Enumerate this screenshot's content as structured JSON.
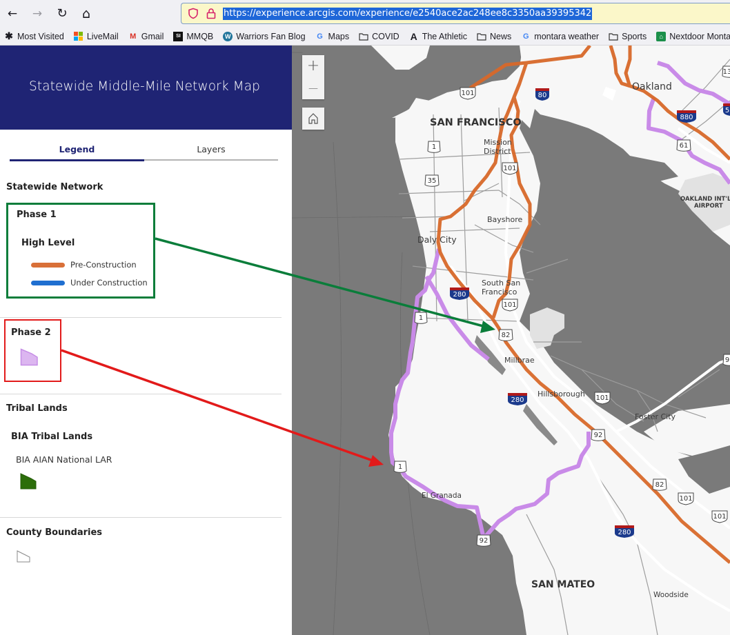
{
  "browser": {
    "back_label": "←",
    "forward_label": "→",
    "reload_label": "↻",
    "home_label": "⌂",
    "url": "https://experience.arcgis.com/experience/e2540ace2ac248ee8c3350aa39395342",
    "bookmarks": [
      {
        "label": "Most Visited",
        "icon": "gear-icon"
      },
      {
        "label": "LiveMail",
        "icon": "microsoft-icon"
      },
      {
        "label": "Gmail",
        "icon": "gmail-icon"
      },
      {
        "label": "MMQB",
        "icon": "si-icon"
      },
      {
        "label": "Warriors Fan Blog",
        "icon": "wordpress-icon"
      },
      {
        "label": "Maps",
        "icon": "google-icon"
      },
      {
        "label": "COVID",
        "icon": "folder-icon"
      },
      {
        "label": "The Athletic",
        "icon": "athletic-icon"
      },
      {
        "label": "News",
        "icon": "folder-icon"
      },
      {
        "label": "montara weather",
        "icon": "google-icon"
      },
      {
        "label": "Sports",
        "icon": "folder-icon"
      },
      {
        "label": "Nextdoor Montara",
        "icon": "nextdoor-icon"
      },
      {
        "label": "",
        "icon": "calendar-icon"
      }
    ]
  },
  "app": {
    "title": "Statewide Middle-Mile Network Map",
    "header_color": "#1f2474",
    "tabs": [
      {
        "label": "Legend",
        "active": true
      },
      {
        "label": "Layers",
        "active": false
      }
    ]
  },
  "legend": {
    "statewide_network": {
      "title": "Statewide Network",
      "phase1": {
        "title": "Phase 1",
        "subtitle": "High Level",
        "items": [
          {
            "label": "Pre-Construction",
            "color": "#d97038"
          },
          {
            "label": "Under Construction",
            "color": "#1f6fd0"
          }
        ]
      },
      "phase2": {
        "title": "Phase 2",
        "color": "#dcb6f0"
      }
    },
    "tribal_lands": {
      "title": "Tribal Lands",
      "subtitle": "BIA Tribal Lands",
      "item_label": "BIA AIAN National LAR",
      "color": "#2c6e0a"
    },
    "county_boundaries": {
      "title": "County Boundaries"
    }
  },
  "map": {
    "zoom_in_label": "+",
    "zoom_out_label": "—",
    "labels": {
      "san_francisco": "SAN FRANCISCO",
      "mission_district_1": "Mission",
      "mission_district_2": "District",
      "oakland": "Oakland",
      "bayshore": "Bayshore",
      "daly_city": "Daly City",
      "south_sf_1": "South San",
      "south_sf_2": "Francisco",
      "millbrae": "Millbrae",
      "hillsborough": "Hillsborough",
      "foster_city": "Foster City",
      "el_granada": "El Granada",
      "san_mateo": "SAN MATEO",
      "woodside": "Woodside",
      "airport_1": "OAKLAND INT'L",
      "airport_2": "AIRPORT"
    },
    "shields": {
      "us101": "101",
      "i80": "80",
      "i880": "880",
      "i280": "280",
      "ca1": "1",
      "ca35": "35",
      "ca61": "61",
      "ca82": "82",
      "ca92": "92",
      "ca13": "13",
      "i580": "5",
      "ca9": "9"
    },
    "colors": {
      "water": "#7a7a7a",
      "land": "#f7f7f7",
      "phase1_route": "#d8692a",
      "phase2_route": "#c98be8"
    }
  },
  "annotations": {
    "green_arrow_color": "#0a7d3a",
    "red_arrow_color": "#e21a1a"
  }
}
